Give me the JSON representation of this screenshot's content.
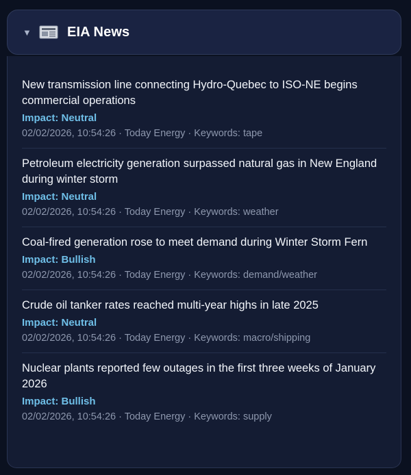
{
  "header": {
    "caret": "▼",
    "icon": "newspaper-icon",
    "title": "EIA News"
  },
  "colors": {
    "impact_label": "#6fbfe8",
    "background": "#0b1120",
    "card": "#1a2342"
  },
  "items": [
    {
      "headline": "New transmission line connecting Hydro-Quebec to ISO-NE begins commercial operations",
      "impact": "Impact: Neutral",
      "meta": "02/02/2026, 10:54:26 · Today Energy · Keywords: tape"
    },
    {
      "headline": "Petroleum electricity generation surpassed natural gas in New England during winter storm",
      "impact": "Impact: Neutral",
      "meta": "02/02/2026, 10:54:26 · Today Energy · Keywords: weather"
    },
    {
      "headline": "Coal-fired generation rose to meet demand during Winter Storm Fern",
      "impact": "Impact: Bullish",
      "meta": "02/02/2026, 10:54:26 · Today Energy · Keywords: demand/weather"
    },
    {
      "headline": "Crude oil tanker rates reached multi-year highs in late 2025",
      "impact": "Impact: Neutral",
      "meta": "02/02/2026, 10:54:26 · Today Energy · Keywords: macro/shipping"
    },
    {
      "headline": "Nuclear plants reported few outages in the first three weeks of January 2026",
      "impact": "Impact: Bullish",
      "meta": "02/02/2026, 10:54:26 · Today Energy · Keywords: supply"
    }
  ]
}
